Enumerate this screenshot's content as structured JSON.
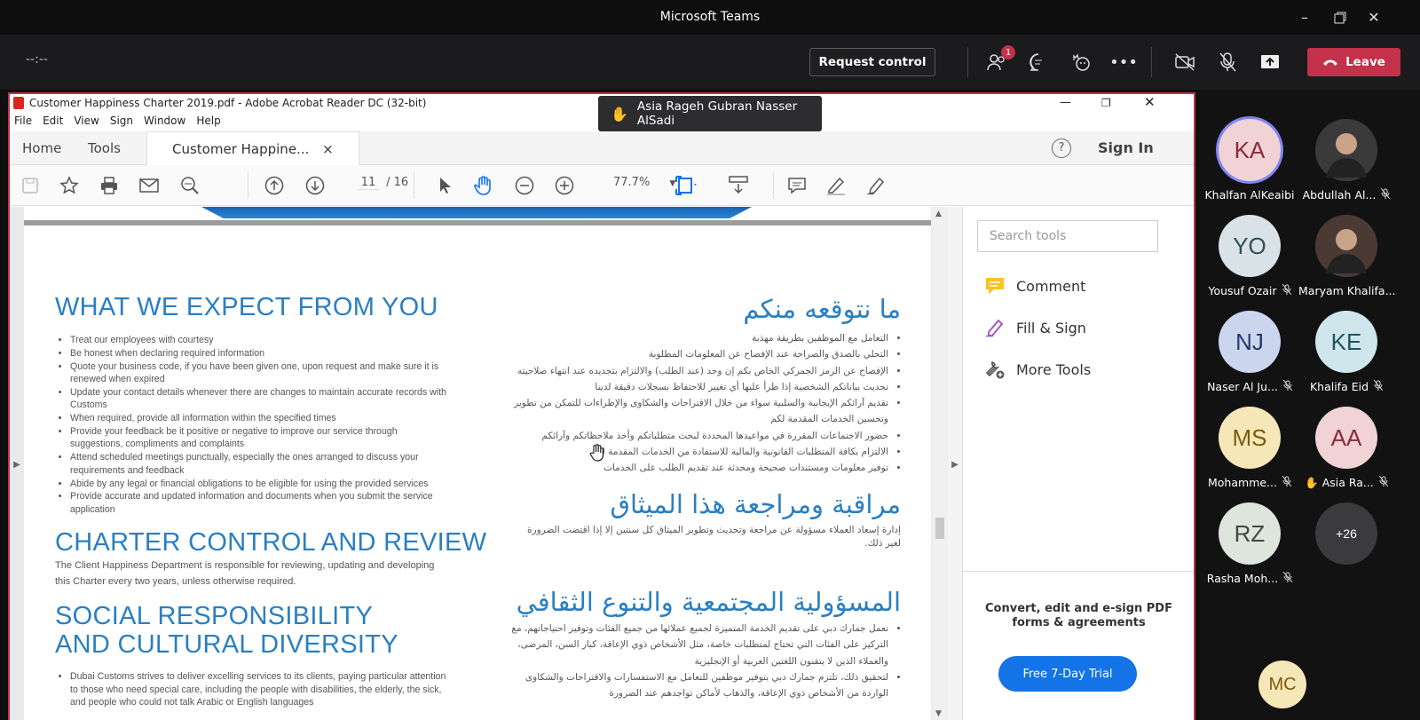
{
  "window": {
    "title": "Microsoft Teams"
  },
  "meeting": {
    "timer": "--:--",
    "request_control": "Request control",
    "participants_badge": "1",
    "leave": "Leave",
    "raised_hand_name": "Asia Rageh Gubran Nasser AlSadi"
  },
  "acrobat": {
    "title": "Customer Happiness Charter 2019.pdf - Adobe Acrobat Reader DC (32-bit)",
    "menu": [
      "File",
      "Edit",
      "View",
      "Sign",
      "Window",
      "Help"
    ],
    "tabs": {
      "home": "Home",
      "tools": "Tools",
      "doc": "Customer Happine...",
      "close": "×"
    },
    "help": "?",
    "sign_in": "Sign In",
    "page_current": "11",
    "page_total": "/ 16",
    "zoom": "77.7%",
    "search_placeholder": "Search tools",
    "panel": {
      "comment": "Comment",
      "fill_sign": "Fill & Sign",
      "more_tools": "More Tools"
    },
    "promo": {
      "text": "Convert, edit and e-sign PDF forms & agreements",
      "button": "Free 7-Day Trial"
    }
  },
  "doc": {
    "h1": "WHAT WE EXPECT FROM YOU",
    "list1": [
      "Treat our employees with courtesy",
      "Be honest when declaring required information",
      "Quote your business code, if you have been given one, upon request and make sure it is renewed when expired",
      "Update your contact details whenever there are changes to maintain accurate records with Customs",
      "When required, provide all information within the specified times",
      "Provide your feedback be it positive or negative to improve our service through suggestions, compliments and complaints",
      "Attend scheduled meetings punctually, especially the ones arranged to discuss your requirements and feedback",
      "Abide by any legal or financial obligations to be eligible for using the provided services",
      "Provide accurate and updated information and documents when you submit the service application"
    ],
    "h2": "CHARTER CONTROL AND REVIEW",
    "p2": "The Client Happiness Department is responsible for reviewing, updating and developing this Charter every two years, unless otherwise required.",
    "h3": "SOCIAL RESPONSIBILITY AND CULTURAL DIVERSITY",
    "list3": [
      "Dubai Customs strives to deliver excelling services to its clients, paying particular attention to those who need special care, including the people with disabilities, the elderly, the sick, and people who could not talk Arabic or English languages"
    ],
    "ar_h1": "ما نتوقعه منكم",
    "ar_list1": [
      "التعامل مع الموظفين بطريقة مهذبة",
      "التحلي بالصدق والصراحة عند الإفصاح عن المعلومات المطلوبة",
      "الإفصاح عن الرمز الجمركي الخاص بكم إن وجد (عند الطلب) والالتزام بتجديده عند انتهاء صلاحيته",
      "تحديث بياناتكم الشخصية إذا طرأ عليها أي تغيير للاحتفاظ بسجلات دقيقة لدينا",
      "تقديم آرائكم الإيجابية والسلبية سواء من خلال الاقتراحات والشكاوى والإطراءات للتمكن من تطوير وتحسين الخدمات المقدمة لكم",
      "حضور الاجتماعات المقررة في مواعيدها المحددة لبحث متطلباتكم وأخذ ملاحظاتكم وآرائكم",
      "الالتزام بكافة المتطلبات القانونية والمالية للاستفادة من الخدمات المقدمة لكم",
      "توفير معلومات ومستندات صحيحة ومحدثة عند تقديم الطلب على الخدمات"
    ],
    "ar_h2": "مراقبة ومراجعة هذا الميثاق",
    "ar_p2": "إدارة إسعاد العملاء مسؤولة عن مراجعة وتحديث وتطوير الميثاق كل سنتين إلا إذا اقتضت الضرورة لغير ذلك.",
    "ar_h3": "المسؤولية المجتمعية والتنوع الثقافي",
    "ar_list3": [
      "تعمل جمارك دبي على تقديم الخدمة المتميزة لجميع عملائها من جميع الفئات وتوفير احتياجاتهم، مع التركيز على الفئات التي تحتاج لمتطلبات خاصة، مثل الأشخاص ذوي الإعاقة، كبار السن، المرضى، والعملاء الذين لا يتقنون اللغتين العربية أو الإنجليزية",
      "لتحقيق ذلك، تلتزم جمارك دبي بتوفير موظفين للتعامل مع الاستفسارات والاقتراحات والشكاوى الواردة من الأشخاص ذوي الإعاقة، والذهاب لأماكن تواجدهم عند الضرورة"
    ]
  },
  "participants": [
    {
      "initials": "KA",
      "name": "Khalfan AlKeaibi",
      "bg": "#f1d3d6",
      "fg": "#8c2a3a",
      "muted": false,
      "hand": false,
      "photo": false,
      "active": true
    },
    {
      "initials": "",
      "name": "Abdullah Al...",
      "bg": "#3a3a3a",
      "fg": "#fff",
      "muted": true,
      "hand": false,
      "photo": true,
      "active": false
    },
    {
      "initials": "YO",
      "name": "Yousuf Ozair",
      "bg": "#d9e2e6",
      "fg": "#2f4f5b",
      "muted": true,
      "hand": false,
      "photo": false,
      "active": false
    },
    {
      "initials": "",
      "name": "Maryam Khalifa...",
      "bg": "#4a3a33",
      "fg": "#fff",
      "muted": false,
      "hand": false,
      "photo": true,
      "active": false
    },
    {
      "initials": "NJ",
      "name": "Naser Al Ju...",
      "bg": "#cbd5ee",
      "fg": "#233a6e",
      "muted": true,
      "hand": false,
      "photo": false,
      "active": false
    },
    {
      "initials": "KE",
      "name": "Khalifa Eid",
      "bg": "#cfe6ec",
      "fg": "#1e5560",
      "muted": true,
      "hand": false,
      "photo": false,
      "active": false
    },
    {
      "initials": "MS",
      "name": "Mohamme...",
      "bg": "#f6e7b8",
      "fg": "#7a5a10",
      "muted": true,
      "hand": false,
      "photo": false,
      "active": false
    },
    {
      "initials": "AA",
      "name": "Asia Ra...",
      "bg": "#f1d3d6",
      "fg": "#8c2a3a",
      "muted": true,
      "hand": true,
      "photo": false,
      "active": false
    },
    {
      "initials": "RZ",
      "name": "Rasha Moh...",
      "bg": "#dde5dd",
      "fg": "#3d4a3d",
      "muted": true,
      "hand": false,
      "photo": false,
      "active": false
    },
    {
      "initials": "+26",
      "name": "",
      "bg": "#3b3a3c",
      "fg": "#fff",
      "muted": false,
      "hand": false,
      "photo": false,
      "active": false
    },
    {
      "initials": "MC",
      "name": "",
      "bg": "#f6e7b8",
      "fg": "#7a5a10",
      "muted": false,
      "hand": false,
      "photo": false,
      "active": false
    }
  ],
  "colors": {
    "teams_bg": "#1b1a1c",
    "leave": "#c4314b",
    "doc_blue": "#2a7fc1",
    "acrobat_blue": "#1473e6"
  }
}
